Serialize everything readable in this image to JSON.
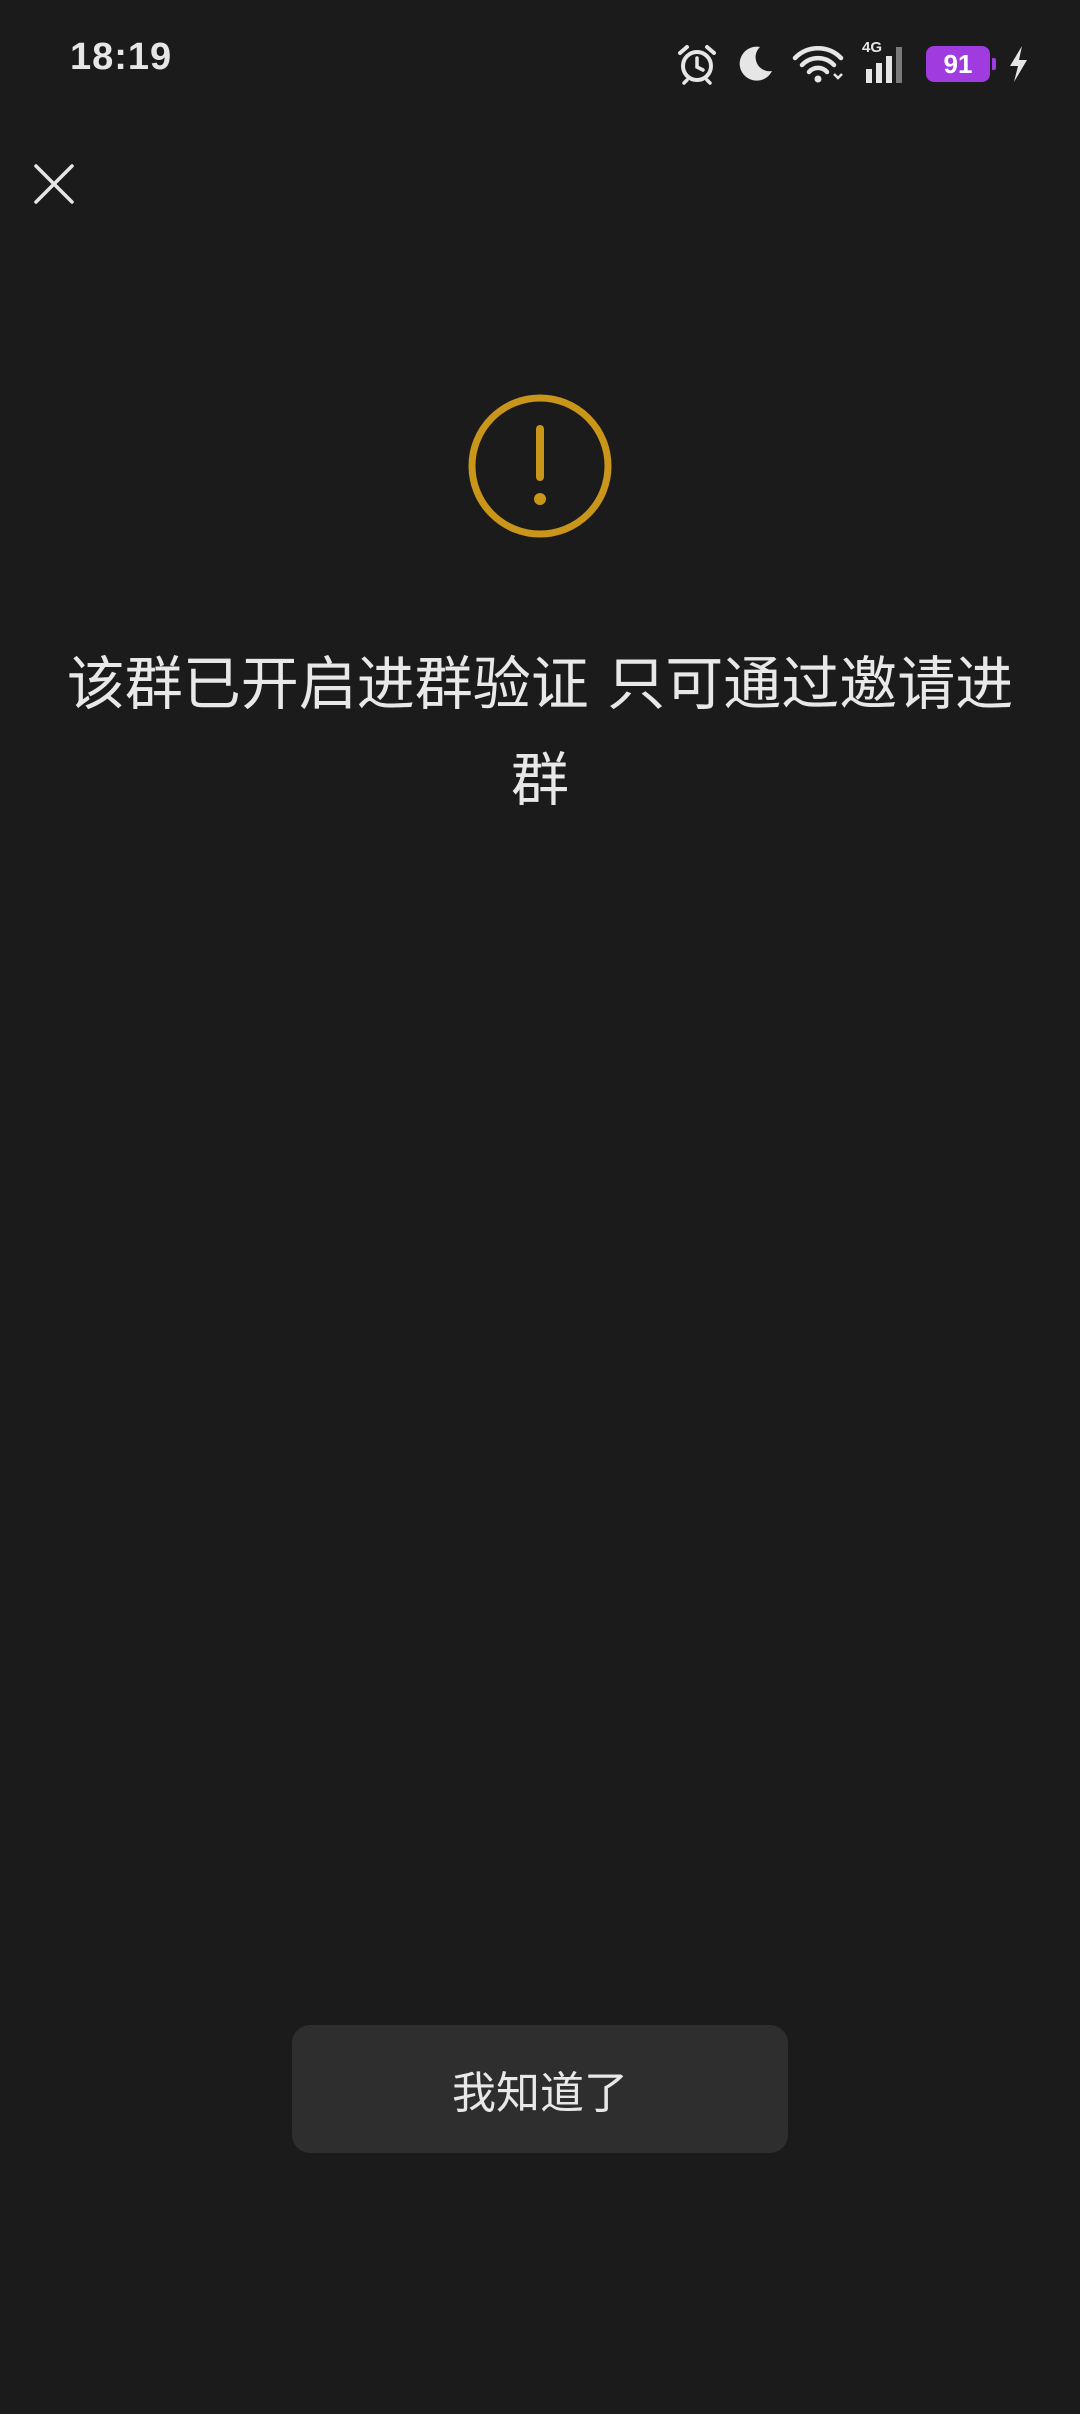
{
  "status_bar": {
    "time": "18:19",
    "network_type": "4G",
    "battery_level": "91",
    "battery_color": "#a03be0",
    "icons": [
      "alarm-icon",
      "moon-icon",
      "wifi-icon",
      "signal-icon",
      "battery-icon",
      "charging-icon"
    ]
  },
  "header": {
    "close_icon": "close-icon"
  },
  "main": {
    "warning_icon": "exclamation-circle-icon",
    "warning_color": "#c9961a",
    "message": "该群已开启进群验证 只可通过邀请进群"
  },
  "footer": {
    "confirm_label": "我知道了"
  }
}
